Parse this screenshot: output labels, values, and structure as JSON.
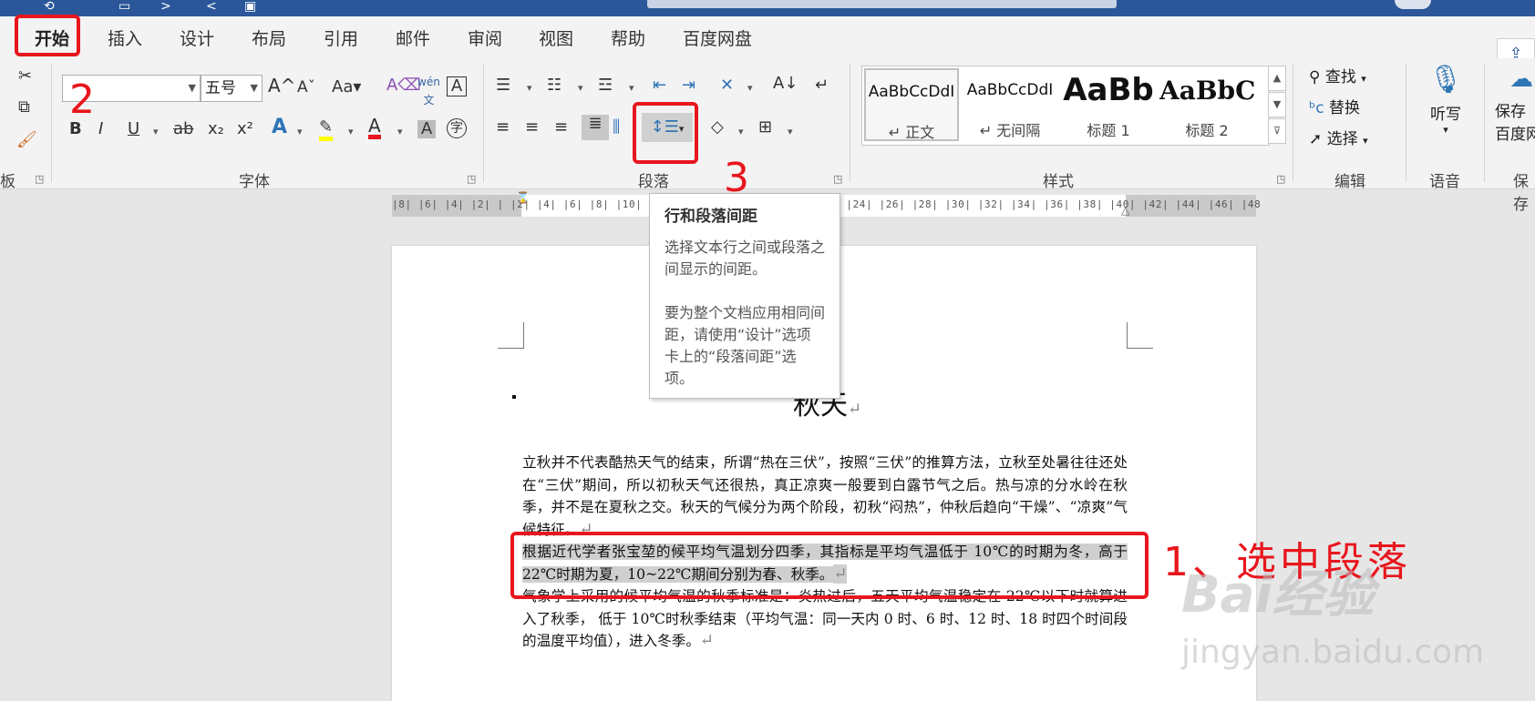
{
  "tabs": [
    "开始",
    "插入",
    "设计",
    "布局",
    "引用",
    "邮件",
    "审阅",
    "视图",
    "帮助",
    "百度网盘"
  ],
  "font": {
    "name_value": "",
    "size_value": "五号",
    "group_label": "字体"
  },
  "paragraph": {
    "group_label": "段落"
  },
  "styles": {
    "group_label": "样式",
    "items": [
      {
        "sample": "AaBbCcDdI",
        "name": "↵ 正文"
      },
      {
        "sample": "AaBbCcDdI",
        "name": "↵ 无间隔"
      },
      {
        "sample": "AaBb",
        "name": "标题 1"
      },
      {
        "sample": "AaBbC",
        "name": "标题 2"
      }
    ]
  },
  "editing": {
    "find": "查找",
    "replace": "替换",
    "select": "选择",
    "group_label": "编辑"
  },
  "voice": {
    "dictate": "听写",
    "group_label": "语音"
  },
  "save": {
    "label1": "保存",
    "label2": "百度网",
    "group_label": "保存"
  },
  "left_clip": {
    "group_label": "板"
  },
  "ruler_marks": "|8| |6| |4| |2| |  |2| |4| |6| |8| |10| |12| |14| |16| |18| |20| |22| |24| |26| |28| |30| |32| |34| |36| |38| |40| |42| |44| |46| |48",
  "tooltip": {
    "title": "行和段落间距",
    "body1": "选择文本行之间或段落之间显示的间距。",
    "body2": "要为整个文档应用相同间距，请使用“设计”选项卡上的“段落间距”选项。"
  },
  "document": {
    "title": "秋天",
    "para_mark": "↵",
    "p1": "立秋并不代表酷热天气的结束，所谓“热在三伏”，按照“三伏”的推算方法，立秋至处暑往往还处在“三伏”期间，所以初秋天气还很热，真正凉爽一般要到白露节气之后。热与凉的分水岭在秋季，并不是在夏秋之交。秋天的气候分为两个阶段，初秋“闷热”，仲秋后趋向“干燥”、“凉爽”气候特征。",
    "p2": "根据近代学者张宝堃的候平均气温划分四季，其指标是平均气温低于 10℃的时期为冬，高于 22℃时期为夏，10~22℃期间分别为春、秋季。",
    "p3": "气象学上采用的候平均气温的秋季标准是：炎热过后，五天平均气温稳定在 22℃以下时就算进入了秋季， 低于 10℃时秋季结束（平均气温：同一天内 0 时、6 时、12 时、18 时四个时间段的温度平均值），进入冬季。"
  },
  "annotations": {
    "num1": "1、选中段落",
    "num2": "2",
    "num3": "3"
  },
  "watermark": {
    "logo": "Bai经验",
    "url": "jingyan.baidu.com"
  }
}
